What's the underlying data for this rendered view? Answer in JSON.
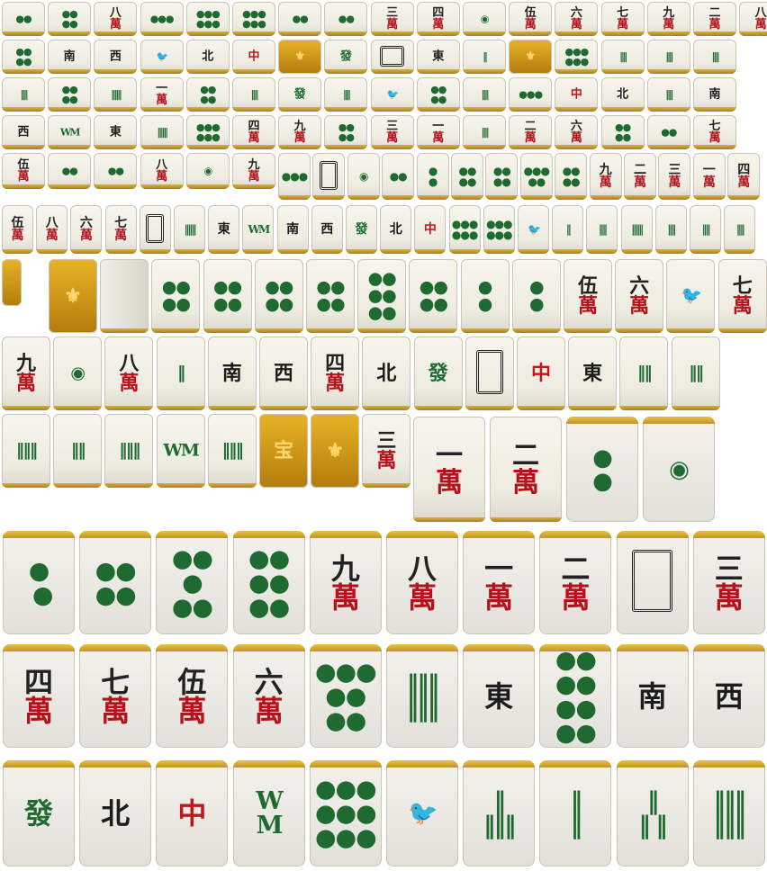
{
  "sheet": {
    "name": "Mahjong tile sprite sheet"
  },
  "tiles": [
    {
      "t": "d",
      "v": "●●"
    },
    {
      "t": "d",
      "v": "●●\n●●"
    },
    {
      "t": "m",
      "n": "八",
      "g": "萬"
    },
    {
      "t": "d",
      "v": "●●●"
    },
    {
      "t": "d",
      "v": "●●●\n●●●"
    },
    {
      "t": "d",
      "v": "●●●\n●●●"
    },
    {
      "t": "d",
      "v": "●●"
    },
    {
      "t": "d",
      "v": "●●"
    },
    {
      "t": "m",
      "n": "三",
      "g": "萬"
    },
    {
      "t": "m",
      "n": "四",
      "g": "萬"
    },
    {
      "t": "d",
      "v": "◉"
    },
    {
      "t": "m",
      "n": "伍",
      "g": "萬"
    },
    {
      "t": "m",
      "n": "六",
      "g": "萬"
    },
    {
      "t": "m",
      "n": "七",
      "g": "萬"
    },
    {
      "t": "m",
      "n": "九",
      "g": "萬"
    },
    {
      "t": "m",
      "n": "二",
      "g": "萬"
    },
    {
      "t": "m",
      "n": "八",
      "g": "萬"
    },
    {
      "t": "d",
      "v": "●●\n●●"
    },
    {
      "t": "w",
      "v": "南"
    },
    {
      "t": "w",
      "v": "西"
    },
    {
      "t": "b",
      "v": "🐦"
    },
    {
      "t": "w",
      "v": "北"
    },
    {
      "t": "r",
      "v": "中"
    },
    {
      "t": "gold",
      "v": "⚜"
    },
    {
      "t": "g",
      "v": "發"
    },
    {
      "t": "frame"
    },
    {
      "t": "w",
      "v": "東"
    },
    {
      "t": "b",
      "v": "‖"
    },
    {
      "t": "gold",
      "v": "⚜"
    },
    {
      "t": "d",
      "v": "●●●\n●●●"
    },
    {
      "t": "b",
      "v": "‖‖"
    },
    {
      "t": "b",
      "v": "‖‖"
    },
    {
      "t": "b",
      "v": "‖‖"
    },
    {
      "t": "b",
      "v": "‖‖"
    },
    {
      "t": "d",
      "v": "●●\n●●"
    },
    {
      "t": "b",
      "v": "‖‖‖"
    },
    {
      "t": "m",
      "n": "一",
      "g": "萬"
    },
    {
      "t": "d",
      "v": "●●\n●●"
    },
    {
      "t": "b",
      "v": "‖‖"
    },
    {
      "t": "g",
      "v": "發"
    },
    {
      "t": "b",
      "v": "‖‖"
    },
    {
      "t": "b",
      "v": "🐦"
    },
    {
      "t": "d",
      "v": "●●\n●●"
    },
    {
      "t": "b",
      "v": "‖‖"
    },
    {
      "t": "d",
      "v": "●●●"
    },
    {
      "t": "r",
      "v": "中"
    },
    {
      "t": "w",
      "v": "北"
    },
    {
      "t": "b",
      "v": "‖‖"
    },
    {
      "t": "w",
      "v": "南"
    },
    {
      "t": "w",
      "v": "西"
    },
    {
      "t": "b",
      "v": "WM"
    },
    {
      "t": "w",
      "v": "東"
    },
    {
      "t": "b",
      "v": "‖‖‖"
    },
    {
      "t": "d",
      "v": "●●●\n●●●"
    },
    {
      "t": "m",
      "n": "四",
      "g": "萬"
    },
    {
      "t": "m",
      "n": "九",
      "g": "萬"
    },
    {
      "t": "d",
      "v": "●●\n●●"
    },
    {
      "t": "m",
      "n": "三",
      "g": "萬"
    },
    {
      "t": "m",
      "n": "一",
      "g": "萬"
    },
    {
      "t": "b",
      "v": "‖‖"
    },
    {
      "t": "m",
      "n": "二",
      "g": "萬"
    },
    {
      "t": "m",
      "n": "六",
      "g": "萬"
    },
    {
      "t": "d",
      "v": "●●\n●●"
    },
    {
      "t": "d",
      "v": "●●"
    },
    {
      "t": "m",
      "n": "七",
      "g": "萬"
    },
    {
      "t": "m",
      "n": "伍",
      "g": "萬"
    },
    {
      "t": "d",
      "v": "●●"
    },
    {
      "t": "d",
      "v": "●●"
    },
    {
      "t": "m",
      "n": "八",
      "g": "萬"
    },
    {
      "t": "d",
      "v": "◉"
    },
    {
      "t": "m",
      "n": "九",
      "g": "萬"
    },
    {
      "t": "d",
      "v": "●●●"
    },
    {
      "t": "frame"
    },
    {
      "t": "d",
      "v": "◉"
    },
    {
      "t": "d",
      "v": "●●"
    },
    {
      "t": "d",
      "v": "●\n●"
    },
    {
      "t": "d",
      "v": "●●\n●●"
    },
    {
      "t": "d",
      "v": "●●\n●●"
    },
    {
      "t": "d",
      "v": "●●●\n●●"
    },
    {
      "t": "d",
      "v": "●●\n●●"
    },
    {
      "t": "m",
      "n": "九",
      "g": "萬"
    },
    {
      "t": "m",
      "n": "二",
      "g": "萬"
    },
    {
      "t": "m",
      "n": "三",
      "g": "萬"
    },
    {
      "t": "m",
      "n": "一",
      "g": "萬"
    },
    {
      "t": "m",
      "n": "四",
      "g": "萬"
    },
    {
      "t": "m",
      "n": "伍",
      "g": "萬"
    },
    {
      "t": "m",
      "n": "八",
      "g": "萬"
    },
    {
      "t": "m",
      "n": "六",
      "g": "萬"
    },
    {
      "t": "m",
      "n": "七",
      "g": "萬"
    },
    {
      "t": "frame"
    },
    {
      "t": "b",
      "v": "‖‖‖"
    },
    {
      "t": "w",
      "v": "東"
    },
    {
      "t": "b",
      "v": "WM"
    },
    {
      "t": "w",
      "v": "南"
    },
    {
      "t": "w",
      "v": "西"
    },
    {
      "t": "g",
      "v": "發"
    },
    {
      "t": "w",
      "v": "北"
    },
    {
      "t": "r",
      "v": "中"
    },
    {
      "t": "d",
      "v": "●●●\n●●●"
    },
    {
      "t": "d",
      "v": "●●●\n●●●"
    },
    {
      "t": "b",
      "v": "🐦"
    },
    {
      "t": "b",
      "v": "‖"
    },
    {
      "t": "b",
      "v": "‖‖"
    },
    {
      "t": "b",
      "v": "‖‖‖"
    },
    {
      "t": "b",
      "v": "‖‖"
    },
    {
      "t": "b",
      "v": "‖‖"
    },
    {
      "t": "b",
      "v": "‖‖"
    },
    {
      "t": "gold",
      "v": ""
    },
    {
      "t": "gold",
      "v": "⚜"
    },
    {
      "t": "side"
    },
    {
      "t": "d",
      "v": "●●\n●●"
    },
    {
      "t": "d",
      "v": "●●\n●●"
    },
    {
      "t": "d",
      "v": "●●\n●●"
    },
    {
      "t": "d",
      "v": "●●\n●●"
    },
    {
      "t": "d",
      "v": "●●\n●●\n●●"
    },
    {
      "t": "d",
      "v": "●●\n●●"
    },
    {
      "t": "d",
      "v": "●\n●"
    },
    {
      "t": "d",
      "v": "●\n●"
    },
    {
      "t": "m",
      "n": "伍",
      "g": "萬"
    },
    {
      "t": "m",
      "n": "六",
      "g": "萬"
    },
    {
      "t": "b",
      "v": "🐦"
    },
    {
      "t": "m",
      "n": "七",
      "g": "萬"
    },
    {
      "t": "m",
      "n": "九",
      "g": "萬"
    },
    {
      "t": "d",
      "v": "◉"
    },
    {
      "t": "m",
      "n": "八",
      "g": "萬"
    },
    {
      "t": "b",
      "v": "‖"
    },
    {
      "t": "w",
      "v": "南"
    },
    {
      "t": "w",
      "v": "西"
    },
    {
      "t": "m",
      "n": "四",
      "g": "萬"
    },
    {
      "t": "w",
      "v": "北"
    },
    {
      "t": "g",
      "v": "發"
    },
    {
      "t": "frame"
    },
    {
      "t": "r",
      "v": "中"
    },
    {
      "t": "w",
      "v": "東"
    },
    {
      "t": "b",
      "v": "‖‖"
    },
    {
      "t": "b",
      "v": "‖‖"
    },
    {
      "t": "b",
      "v": "‖‖‖"
    },
    {
      "t": "b",
      "v": "‖‖"
    },
    {
      "t": "b",
      "v": "‖‖‖"
    },
    {
      "t": "b",
      "v": "WM"
    },
    {
      "t": "b",
      "v": "‖‖‖"
    },
    {
      "t": "gold",
      "v": "宝"
    },
    {
      "t": "gold",
      "v": "⚜"
    },
    {
      "t": "m",
      "n": "三",
      "g": "萬"
    },
    {
      "t": "m",
      "n": "一",
      "g": "萬"
    },
    {
      "t": "m",
      "n": "二",
      "g": "萬"
    },
    {
      "t": "d",
      "v": "●\n●",
      "big": 1
    },
    {
      "t": "d",
      "v": "◉",
      "big": 1
    },
    {
      "t": "d",
      "v": "●\n ●",
      "big": 1
    },
    {
      "t": "d",
      "v": "●●\n●●",
      "big": 1
    },
    {
      "t": "d",
      "v": "●●\n ● \n●●",
      "big": 1
    },
    {
      "t": "d",
      "v": "●●\n●●\n●●",
      "big": 1
    },
    {
      "t": "m",
      "n": "九",
      "g": "萬",
      "big": 1
    },
    {
      "t": "m",
      "n": "八",
      "g": "萬",
      "big": 1
    },
    {
      "t": "m",
      "n": "一",
      "g": "萬",
      "big": 1
    },
    {
      "t": "m",
      "n": "二",
      "g": "萬",
      "big": 1
    },
    {
      "t": "frame",
      "big": 1
    },
    {
      "t": "m",
      "n": "三",
      "g": "萬",
      "big": 1
    },
    {
      "t": "m",
      "n": "四",
      "g": "萬",
      "big": 1
    },
    {
      "t": "m",
      "n": "七",
      "g": "萬",
      "big": 1
    },
    {
      "t": "m",
      "n": "伍",
      "g": "萬",
      "big": 1
    },
    {
      "t": "m",
      "n": "六",
      "g": "萬",
      "big": 1
    },
    {
      "t": "d",
      "v": "●●●\n●●\n●●",
      "big": 1
    },
    {
      "t": "b",
      "v": "‖‖‖\n‖‖‖",
      "big": 1
    },
    {
      "t": "w",
      "v": "東",
      "big": 1
    },
    {
      "t": "d",
      "v": "●●\n●●\n●●\n●●",
      "big": 1
    },
    {
      "t": "w",
      "v": "南",
      "big": 1
    },
    {
      "t": "w",
      "v": "西",
      "big": 1
    },
    {
      "t": "g",
      "v": "發",
      "big": 1
    },
    {
      "t": "w",
      "v": "北",
      "big": 1
    },
    {
      "t": "r",
      "v": "中",
      "big": 1
    },
    {
      "t": "b",
      "v": "W\nM",
      "big": 1
    },
    {
      "t": "d",
      "v": "●●●\n●●●\n●●●",
      "big": 1
    },
    {
      "t": "b",
      "v": "🐦",
      "big": 1
    },
    {
      "t": "b",
      "v": "‖\n‖‖‖",
      "big": 1
    },
    {
      "t": "b",
      "v": "‖\n‖",
      "big": 1
    },
    {
      "t": "b",
      "v": "‖\n‖ ‖",
      "big": 1
    },
    {
      "t": "b",
      "v": "‖‖‖\n‖‖‖",
      "big": 1
    },
    {
      "t": "b",
      "v": "‖‖\n‖‖",
      "big": 1
    },
    {
      "t": "b",
      "v": "‖‖\n‖‖",
      "big": 1
    }
  ]
}
